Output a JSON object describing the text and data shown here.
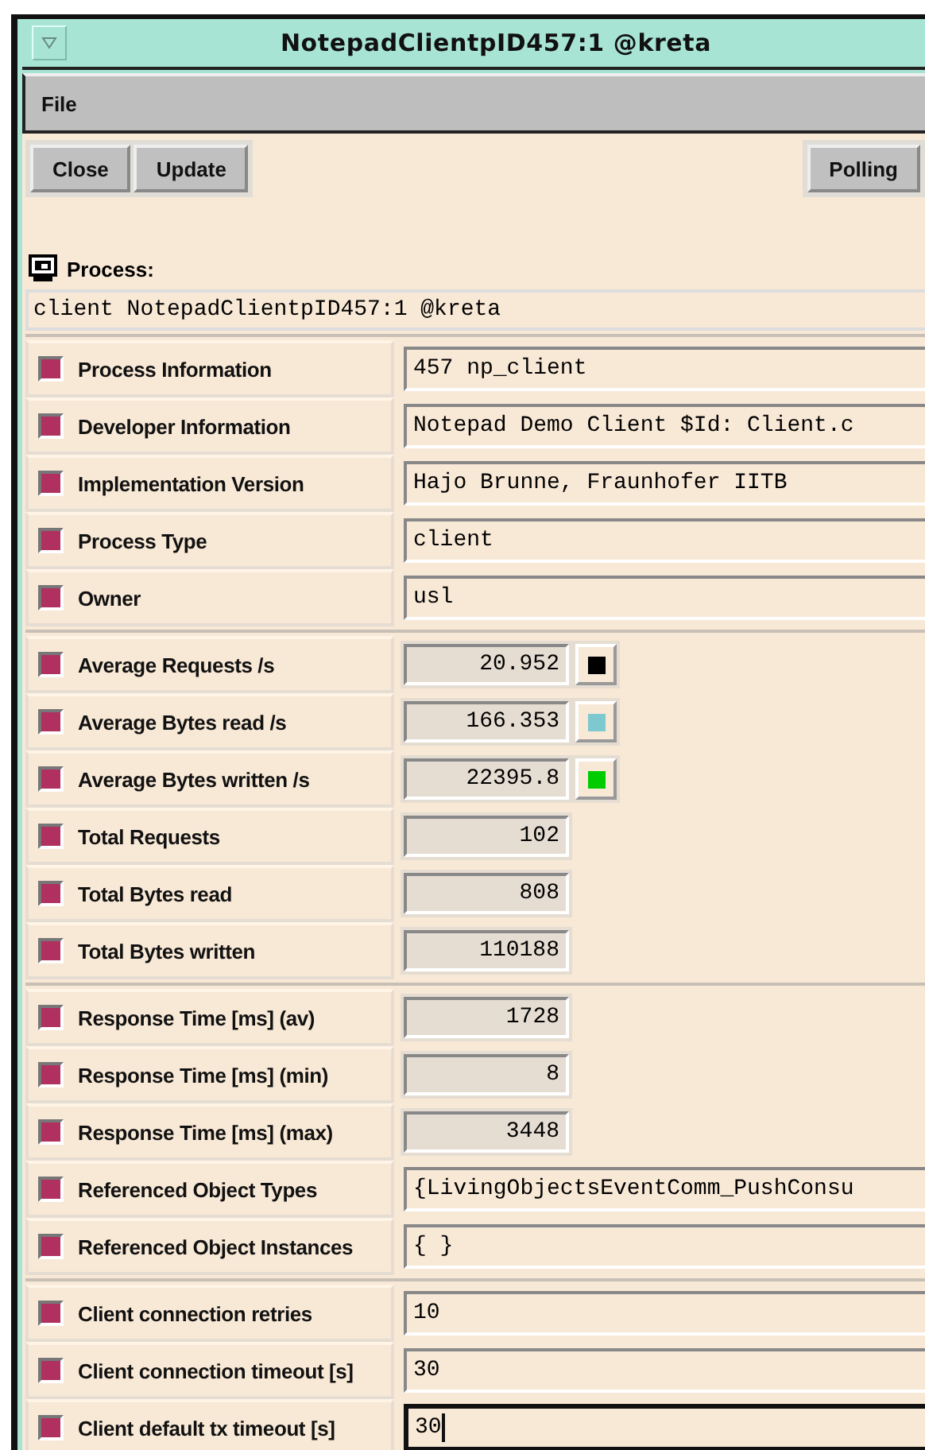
{
  "window": {
    "title": "NotepadClientpID457:1 @kreta"
  },
  "menu": [
    "File"
  ],
  "toolbar": {
    "left": [
      "Close",
      "Update"
    ],
    "right": [
      "Polling"
    ]
  },
  "process": {
    "label": "Process:",
    "value": "client NotepadClientpID457:1 @kreta"
  },
  "sections": [
    {
      "rows": [
        {
          "kind": "text",
          "label": "Process Information",
          "value": "457 np_client",
          "on": true
        },
        {
          "kind": "text",
          "label": "Developer Information",
          "value": "Notepad Demo Client $Id: Client.c",
          "on": true
        },
        {
          "kind": "text",
          "label": "Implementation Version",
          "value": "Hajo Brunne, Fraunhofer IITB",
          "on": true
        },
        {
          "kind": "text",
          "label": "Process Type",
          "value": "client",
          "on": true
        },
        {
          "kind": "text",
          "label": "Owner",
          "value": "usl",
          "on": true
        }
      ]
    },
    {
      "rows": [
        {
          "kind": "number",
          "label": "Average Requests /s",
          "value": "20.952",
          "on": true,
          "color": "#000000"
        },
        {
          "kind": "number",
          "label": "Average Bytes read /s",
          "value": "166.353",
          "on": true,
          "color": "#7ec8d0"
        },
        {
          "kind": "number",
          "label": "Average Bytes written /s",
          "value": "22395.8",
          "on": true,
          "color": "#00cc00"
        },
        {
          "kind": "number",
          "label": "Total Requests",
          "value": "102",
          "on": true
        },
        {
          "kind": "number",
          "label": "Total Bytes read",
          "value": "808",
          "on": true
        },
        {
          "kind": "number",
          "label": "Total Bytes written",
          "value": "110188",
          "on": true
        }
      ]
    },
    {
      "rows": [
        {
          "kind": "number",
          "label": "Response Time [ms] (av)",
          "value": "1728",
          "on": true
        },
        {
          "kind": "number",
          "label": "Response Time [ms] (min)",
          "value": "8",
          "on": true
        },
        {
          "kind": "number",
          "label": "Response Time [ms] (max)",
          "value": "3448",
          "on": true
        },
        {
          "kind": "text",
          "label": "Referenced Object Types",
          "value": "{LivingObjectsEventComm_PushConsu",
          "on": true
        },
        {
          "kind": "text",
          "label": "Referenced Object Instances",
          "value": "{ }",
          "on": true
        }
      ]
    },
    {
      "rows": [
        {
          "kind": "editable",
          "label": "Client connection retries",
          "value": "10",
          "on": true,
          "focused": false
        },
        {
          "kind": "editable",
          "label": "Client connection timeout [s]",
          "value": "30",
          "on": true,
          "focused": false
        },
        {
          "kind": "editable",
          "label": "Client default tx timeout [s]",
          "value": "30",
          "on": true,
          "focused": true
        }
      ]
    }
  ]
}
